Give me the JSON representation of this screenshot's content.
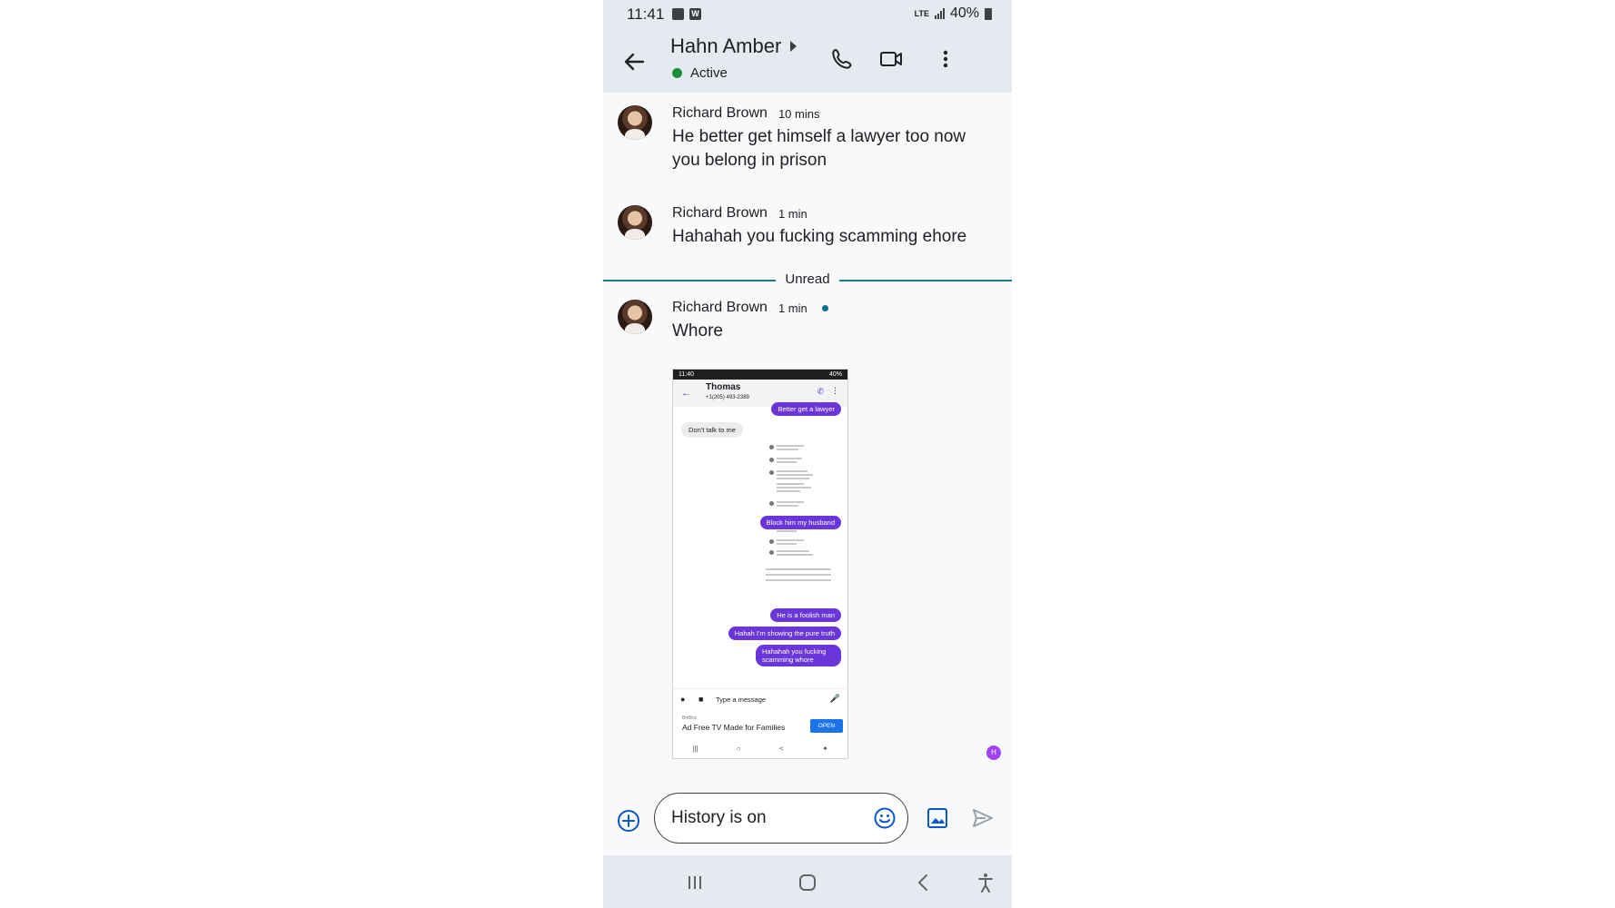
{
  "status_bar": {
    "time": "11:41",
    "network": "LTE",
    "battery": "40%"
  },
  "header": {
    "contact_name": "Hahn Amber",
    "presence": "Active",
    "presence_color": "#1e8e3e"
  },
  "messages": [
    {
      "sender": "Richard Brown",
      "time": "10 mins",
      "text": "He better get himself a lawyer too now you belong in prison"
    },
    {
      "sender": "Richard Brown",
      "time": "1 min",
      "text": "Hahahah you fucking scamming ehore"
    },
    {
      "sender": "Richard Brown",
      "time": "1 min",
      "text": "Whore",
      "unread": true
    }
  ],
  "divider_label": "Unread",
  "attachment": {
    "status_time": "11:40",
    "status_battery": "40%",
    "contact": "Thomas",
    "number": "+1(205) 493-2389",
    "bubbles": {
      "b1": "Better get a lawyer",
      "b2": "Don't talk to me",
      "b3": "Block him my husband",
      "b4": "He is a foolish man",
      "b5": "Hahah I'm showing the pure truth",
      "b6": "Hahahah you fucking scamming whore"
    },
    "input_placeholder": "Type a message",
    "ad_sponsor": "BritBox",
    "ad_text": "Ad Free TV Made for Families",
    "ad_button": "OPEN"
  },
  "reaction_initial": "H",
  "composer": {
    "value": "History is on"
  },
  "colors": {
    "bar_bg": "#e6eaf0",
    "unread_line": "#1a7f80",
    "bubble_purple": "#6a36d9"
  },
  "icons": {
    "back": "arrow-left",
    "call": "phone",
    "video": "video-camera",
    "more": "three-dots-vertical",
    "add": "plus-circle",
    "emoji": "smiley",
    "gallery": "image",
    "send": "send-arrow"
  }
}
